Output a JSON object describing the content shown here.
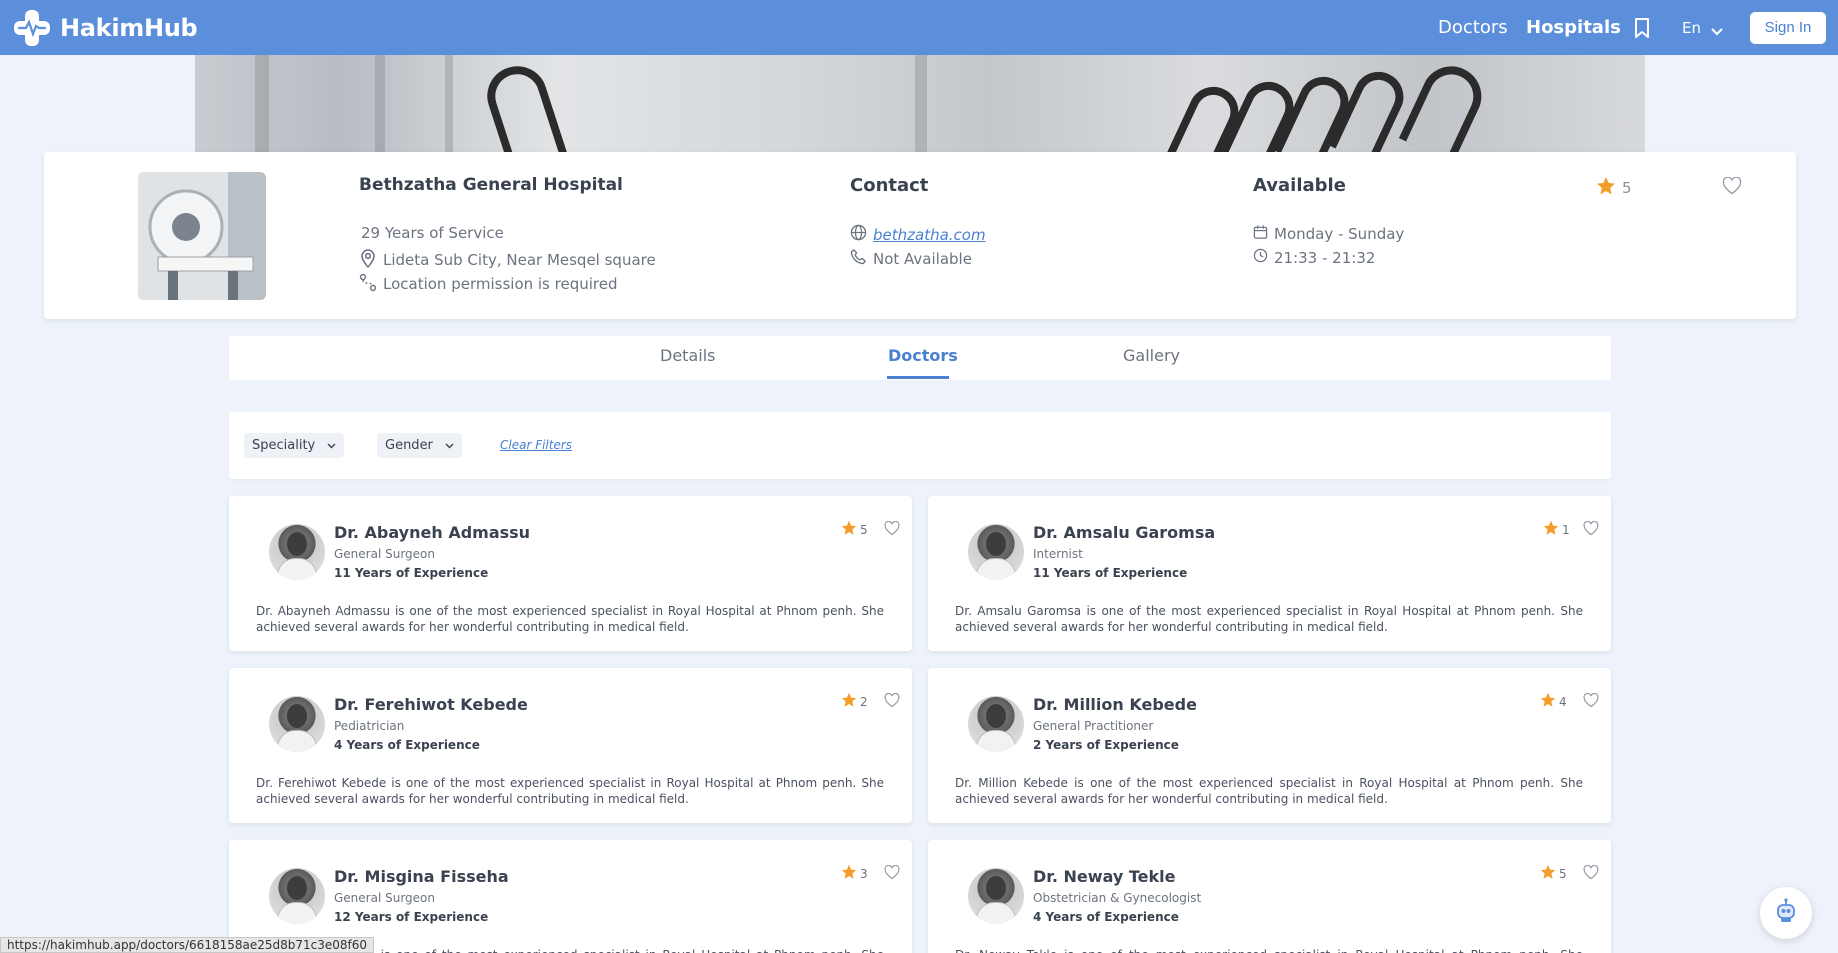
{
  "header": {
    "logo_text": "HakimHub",
    "nav_doctors": "Doctors",
    "nav_hospitals": "Hospitals",
    "language": "En",
    "signin_label": "Sign In"
  },
  "hospital": {
    "name": "Bethzatha General Hospital",
    "years_of_service": "29 Years of Service",
    "address": "Lideta Sub City, Near Mesqel square",
    "location_note": "Location permission is required",
    "contact_title": "Contact",
    "website": "bethzatha.com",
    "phone": "Not Available",
    "available_title": "Available",
    "days": "Monday - Sunday",
    "hours": "21:33 - 21:32",
    "rating": "5"
  },
  "tabs": [
    {
      "label": "Details",
      "active": false
    },
    {
      "label": "Doctors",
      "active": true
    },
    {
      "label": "Gallery",
      "active": false
    }
  ],
  "filters": {
    "speciality": "Speciality",
    "gender": "Gender",
    "clear": "Clear Filters"
  },
  "doctors": [
    {
      "name": "Dr. Abayneh Admassu",
      "speciality": "General Surgeon",
      "experience": "11 Years of Experience",
      "rating": "5",
      "description": "Dr. Abayneh Admassu is one of the most experienced specialist in Royal Hospital at Phnom penh. She achieved several awards for her wonderful contributing in medical field."
    },
    {
      "name": "Dr. Amsalu Garomsa",
      "speciality": "Internist",
      "experience": "11 Years of Experience",
      "rating": "1",
      "description": "Dr. Amsalu Garomsa is one of the most experienced specialist in Royal Hospital at Phnom penh. She achieved several awards for her wonderful contributing in medical field."
    },
    {
      "name": "Dr. Ferehiwot Kebede",
      "speciality": "Pediatrician",
      "experience": "4 Years of Experience",
      "rating": "2",
      "description": "Dr. Ferehiwot Kebede is one of the most experienced specialist in Royal Hospital at Phnom penh. She achieved several awards for her wonderful contributing in medical field."
    },
    {
      "name": "Dr. Million Kebede",
      "speciality": "General Practitioner",
      "experience": "2 Years of Experience",
      "rating": "4",
      "description": "Dr. Million Kebede is one of the most experienced specialist in Royal Hospital at Phnom penh. She achieved several awards for her wonderful contributing in medical field."
    },
    {
      "name": "Dr. Misgina Fisseha",
      "speciality": "General Surgeon",
      "experience": "12 Years of Experience",
      "rating": "3",
      "description": "Dr. Misgina Fisseha is one of the most experienced specialist in Royal Hospital at Phnom penh. She achieved several awards for her wonderful contributing in medical field."
    },
    {
      "name": "Dr. Neway Tekle",
      "speciality": "Obstetrician & Gynecologist",
      "experience": "4 Years of Experience",
      "rating": "5",
      "description": "Dr. Neway Tekle is one of the most experienced specialist in Royal Hospital at Phnom penh. She achieved several awards for her wonderful contributing in medical field."
    }
  ],
  "status_url": "https://hakimhub.app/doctors/6618158ae25d8b71c3e08f60",
  "colors": {
    "primary": "#5b8fdb",
    "accent": "#4a7fd2",
    "star": "#f39c2b",
    "background": "#eef3fb"
  }
}
